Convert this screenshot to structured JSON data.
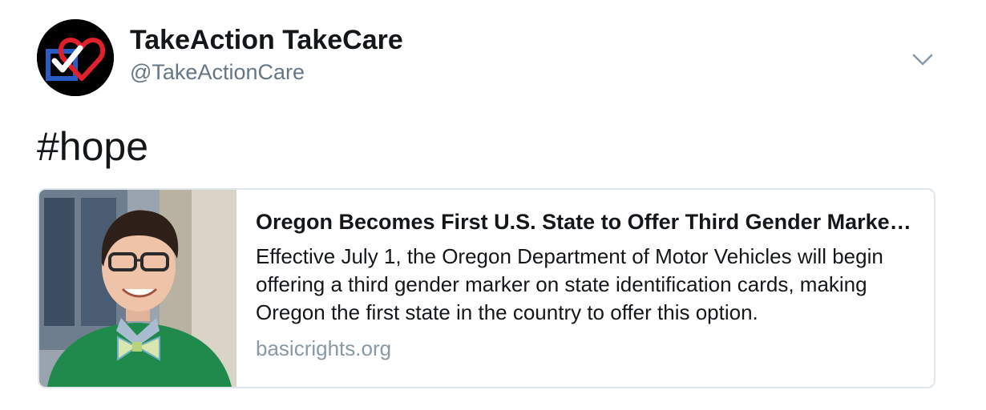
{
  "tweet": {
    "display_name": "TakeAction TakeCare",
    "handle": "@TakeActionCare",
    "text": "#hope",
    "avatar_icon": "heart-checkmark-logo-icon",
    "menu_icon": "chevron-down-icon"
  },
  "card": {
    "title": "Oregon Becomes First U.S. State to Offer Third Gender Marker on State Identification Cards",
    "description": "Effective July 1, the Oregon Department of Motor Vehicles will begin offering a third gender marker on state identification cards, making Oregon the first state in the country to offer this option.",
    "domain": "basicrights.org"
  },
  "colors": {
    "text": "#14171a",
    "secondary": "#657786",
    "domain": "#8899a6",
    "border": "#e1e8ed",
    "logo_heart": "#e0202a",
    "logo_box": "#2a5cc6"
  }
}
